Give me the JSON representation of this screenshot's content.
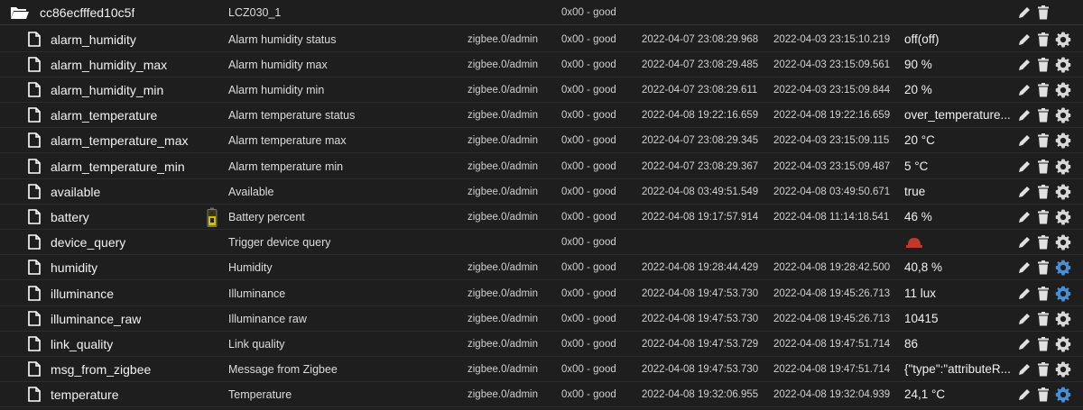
{
  "device": {
    "id": "cc86ecfffed10c5f",
    "name": "LCZ030_1",
    "quality": "0x00 - good"
  },
  "colors": {
    "gear_default": "#d8d8d8",
    "gear_active": "#4a8fd6",
    "bell": "#c0392b",
    "battery": "#d4c000"
  },
  "states": [
    {
      "id": "alarm_humidity",
      "name": "Alarm humidity status",
      "from": "zigbee.0/admin",
      "q": "0x00 - good",
      "ts": "2022-04-07 23:08:29.968",
      "lc": "2022-04-03 23:15:10.219",
      "value": "off(off)",
      "gear": "gear-icon"
    },
    {
      "id": "alarm_humidity_max",
      "name": "Alarm humidity max",
      "from": "zigbee.0/admin",
      "q": "0x00 - good",
      "ts": "2022-04-07 23:08:29.485",
      "lc": "2022-04-03 23:15:09.561",
      "value": "90 %",
      "gear": "gear-icon"
    },
    {
      "id": "alarm_humidity_min",
      "name": "Alarm humidity min",
      "from": "zigbee.0/admin",
      "q": "0x00 - good",
      "ts": "2022-04-07 23:08:29.611",
      "lc": "2022-04-03 23:15:09.844",
      "value": "20 %",
      "gear": "gear-icon"
    },
    {
      "id": "alarm_temperature",
      "name": "Alarm temperature status",
      "from": "zigbee.0/admin",
      "q": "0x00 - good",
      "ts": "2022-04-08 19:22:16.659",
      "lc": "2022-04-08 19:22:16.659",
      "value": "over_temperature...",
      "gear": "gear-icon"
    },
    {
      "id": "alarm_temperature_max",
      "name": "Alarm temperature max",
      "from": "zigbee.0/admin",
      "q": "0x00 - good",
      "ts": "2022-04-07 23:08:29.345",
      "lc": "2022-04-03 23:15:09.115",
      "value": "20 °C",
      "gear": "gear-icon"
    },
    {
      "id": "alarm_temperature_min",
      "name": "Alarm temperature min",
      "from": "zigbee.0/admin",
      "q": "0x00 - good",
      "ts": "2022-04-07 23:08:29.367",
      "lc": "2022-04-03 23:15:09.487",
      "value": "5 °C",
      "gear": "gear-icon"
    },
    {
      "id": "available",
      "name": "Available",
      "from": "zigbee.0/admin",
      "q": "0x00 - good",
      "ts": "2022-04-08 03:49:51.549",
      "lc": "2022-04-08 03:49:50.671",
      "value": "true",
      "gear": "gear-icon"
    },
    {
      "id": "battery",
      "name": "Battery percent",
      "from": "zigbee.0/admin",
      "q": "0x00 - good",
      "ts": "2022-04-08 19:17:57.914",
      "lc": "2022-04-08 11:14:18.541",
      "value": "46 %",
      "gear": "gear-icon"
    },
    {
      "id": "device_query",
      "name": "Trigger device query",
      "from": "",
      "q": "0x00 - good",
      "ts": "",
      "lc": "",
      "value": "",
      "gear": "gear-icon"
    },
    {
      "id": "humidity",
      "name": "Humidity",
      "from": "zigbee.0/admin",
      "q": "0x00 - good",
      "ts": "2022-04-08 19:28:44.429",
      "lc": "2022-04-08 19:28:42.500",
      "value": "40,8 %",
      "gear": "gear-active-icon"
    },
    {
      "id": "illuminance",
      "name": "Illuminance",
      "from": "zigbee.0/admin",
      "q": "0x00 - good",
      "ts": "2022-04-08 19:47:53.730",
      "lc": "2022-04-08 19:45:26.713",
      "value": "11 lux",
      "gear": "gear-active-icon"
    },
    {
      "id": "illuminance_raw",
      "name": "Illuminance raw",
      "from": "zigbee.0/admin",
      "q": "0x00 - good",
      "ts": "2022-04-08 19:47:53.730",
      "lc": "2022-04-08 19:45:26.713",
      "value": "10415",
      "gear": "gear-icon"
    },
    {
      "id": "link_quality",
      "name": "Link quality",
      "from": "zigbee.0/admin",
      "q": "0x00 - good",
      "ts": "2022-04-08 19:47:53.729",
      "lc": "2022-04-08 19:47:51.714",
      "value": "86",
      "gear": "gear-icon"
    },
    {
      "id": "msg_from_zigbee",
      "name": "Message from Zigbee",
      "from": "zigbee.0/admin",
      "q": "0x00 - good",
      "ts": "2022-04-08 19:47:53.730",
      "lc": "2022-04-08 19:47:51.714",
      "value": "{\"type\":\"attributeR...",
      "gear": "gear-icon"
    },
    {
      "id": "temperature",
      "name": "Temperature",
      "from": "zigbee.0/admin",
      "q": "0x00 - good",
      "ts": "2022-04-08 19:32:06.955",
      "lc": "2022-04-08 19:32:04.939",
      "value": "24,1 °C",
      "gear": "gear-active-icon"
    }
  ]
}
